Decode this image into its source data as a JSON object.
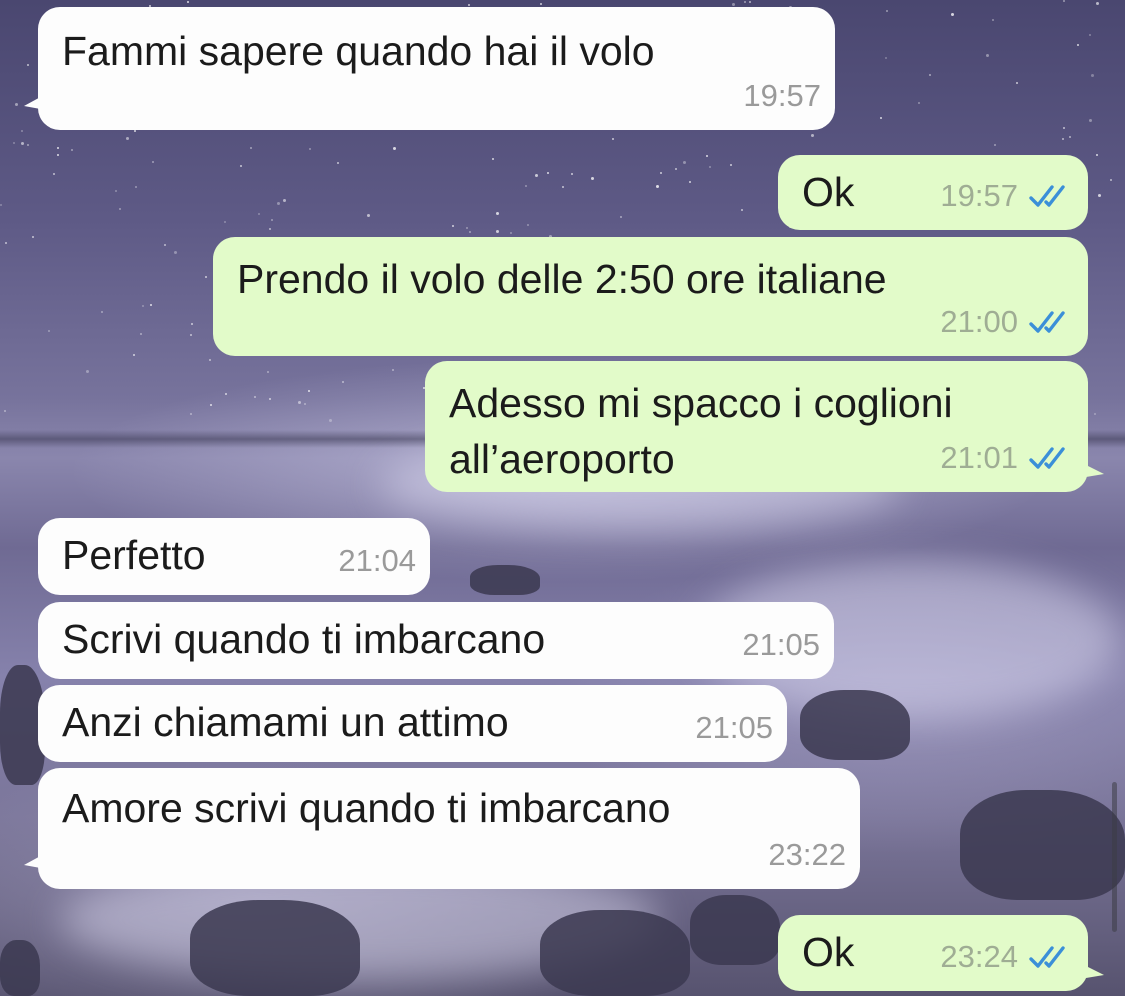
{
  "messages": [
    {
      "dir": "in",
      "text": "Fammi sapere quando hai il volo",
      "time": "19:57"
    },
    {
      "dir": "out",
      "text": "Ok",
      "time": "19:57",
      "status": "double-check-read"
    },
    {
      "dir": "out",
      "text": "Prendo il volo delle 2:50 ore italiane",
      "time": "21:00",
      "status": "double-check-read"
    },
    {
      "dir": "out",
      "text": "Adesso mi spacco i coglioni",
      "text2": "all’aeroporto",
      "time": "21:01",
      "status": "double-check-read"
    },
    {
      "dir": "in",
      "text": "Perfetto",
      "time": "21:04"
    },
    {
      "dir": "in",
      "text": "Scrivi quando ti imbarcano",
      "time": "21:05"
    },
    {
      "dir": "in",
      "text": "Anzi chiamami un attimo",
      "time": "21:05"
    },
    {
      "dir": "in",
      "text": "Amore scrivi quando ti imbarcano",
      "time": "23:22"
    },
    {
      "dir": "out",
      "text": "Ok",
      "time": "23:24",
      "status": "double-check-read"
    }
  ],
  "colors": {
    "incoming_bubble": "#fdfdfd",
    "outgoing_bubble": "#e2fbc9",
    "read_check": "#3b8fd8",
    "timestamp_in": "#9a9a9a",
    "timestamp_out": "#9fad94"
  },
  "icons": {
    "read_receipt": "double-check-icon"
  }
}
